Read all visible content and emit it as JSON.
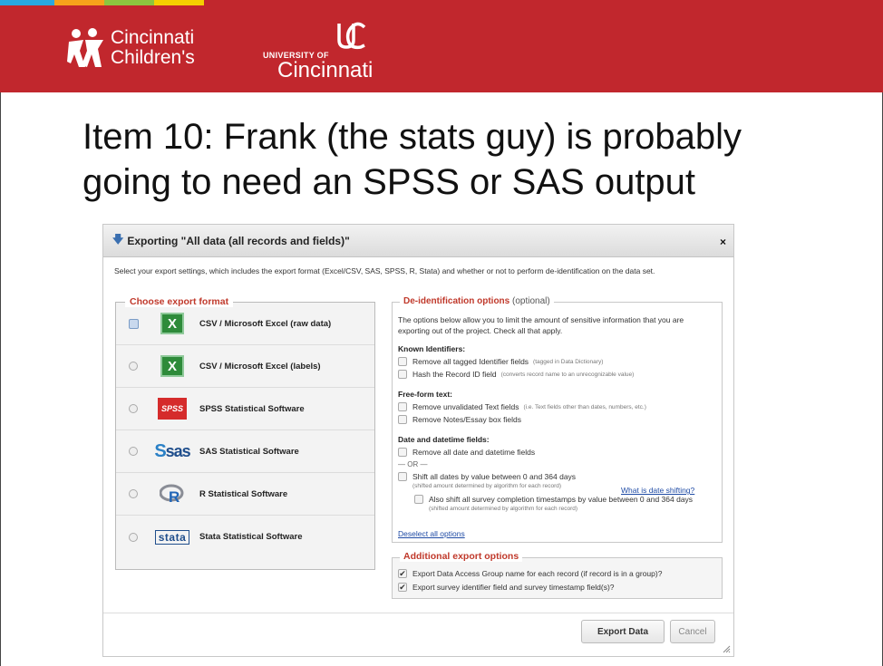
{
  "brand": {
    "stripe_colors": [
      "#29a8e0",
      "#f7a21b",
      "#8cc63f",
      "#f5d000"
    ],
    "header_color": "#c1272d",
    "cc_logo_line1": "Cincinnati",
    "cc_logo_line2": "Children's",
    "uc_logo_small": "UNIVERSITY OF",
    "uc_logo_big": "Cincinnati"
  },
  "slide": {
    "title_line1": "Item 10: Frank (the stats guy) is probably",
    "title_line2": "going to need an SPSS or SAS output"
  },
  "dialog": {
    "title": "Exporting \"All data (all records and fields)\"",
    "close": "×",
    "intro": "Select your export settings, which includes the export format (Excel/CSV, SAS, SPSS, R, Stata) and whether or not to perform de-identification on the data set.",
    "formats_legend": "Choose export format",
    "formats": [
      {
        "label": "CSV / Microsoft Excel (raw data)",
        "icon": "excel-icon",
        "selected": true
      },
      {
        "label": "CSV / Microsoft Excel (labels)",
        "icon": "excel-icon",
        "selected": false
      },
      {
        "label": "SPSS Statistical Software",
        "icon": "spss-icon",
        "selected": false
      },
      {
        "label": "SAS Statistical Software",
        "icon": "sas-icon",
        "selected": false
      },
      {
        "label": "R Statistical Software",
        "icon": "r-icon",
        "selected": false
      },
      {
        "label": "Stata Statistical Software",
        "icon": "stata-icon",
        "selected": false
      }
    ],
    "icon_text": {
      "excel": "X",
      "spss": "SPSS",
      "sas": "sas",
      "stata": "stata"
    },
    "deid": {
      "legend": "De-identification options",
      "legend_optional": "(optional)",
      "description": "The options below allow you to limit the amount of sensitive information that you are exporting out of the project. Check all that apply.",
      "known_identifiers_heading": "Known Identifiers:",
      "remove_identifiers": "Remove all tagged Identifier fields",
      "remove_identifiers_note": "(tagged in Data Dictionary)",
      "hash_record_id": "Hash the Record ID field",
      "hash_record_id_note": "(converts record name to an unrecognizable value)",
      "freeform_heading": "Free-form text:",
      "remove_text": "Remove unvalidated Text fields",
      "remove_text_note": "(i.e. Text fields other than dates, numbers, etc.)",
      "remove_notes": "Remove Notes/Essay box fields",
      "dates_heading": "Date and datetime fields:",
      "remove_dates": "Remove all date and datetime fields",
      "or_text": "— OR —",
      "shift_dates": "Shift all dates by value between 0 and 364 days",
      "shift_dates_note": "(shifted amount determined by algorithm for each record)",
      "what_is_shifting": "What is date shifting?",
      "shift_survey": "Also shift all survey completion timestamps by value between 0 and 364 days",
      "shift_survey_note": "(shifted amount determined by algorithm for each record)",
      "deselect_all": "Deselect all options"
    },
    "additional": {
      "legend": "Additional export options",
      "dag": "Export Data Access Group name for each record (if record is in a group)?",
      "survey_fields": "Export survey identifier field and survey timestamp field(s)?",
      "checkmark": "✔"
    },
    "export_button": "Export Data",
    "cancel_button": "Cancel"
  }
}
